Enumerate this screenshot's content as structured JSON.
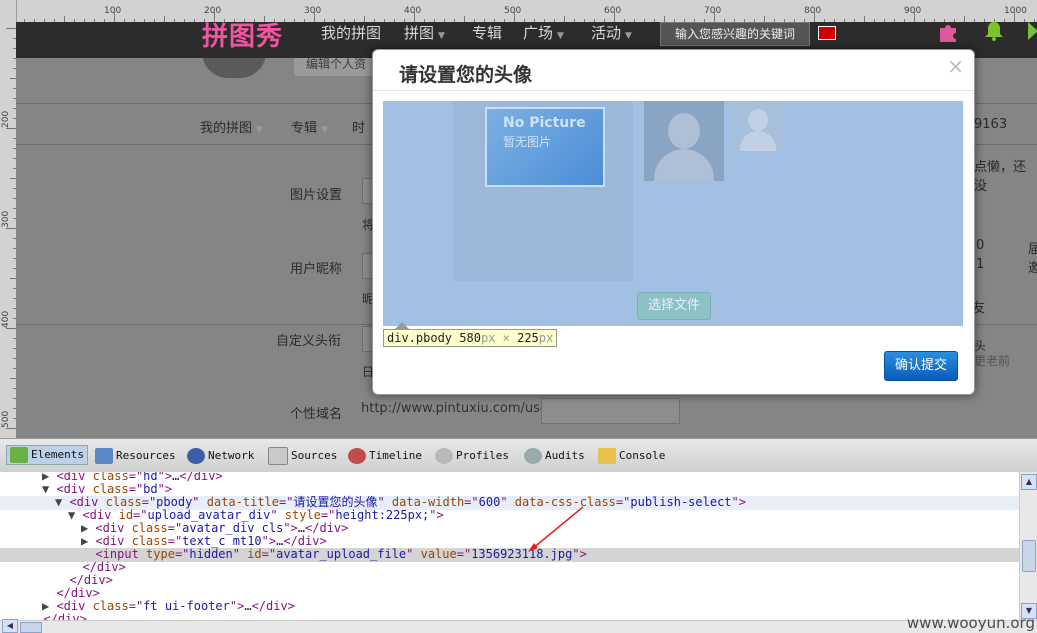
{
  "ruler": {
    "labels": [
      "100",
      "200",
      "300",
      "400",
      "500",
      "600",
      "700",
      "800",
      "900",
      "1000"
    ],
    "vlabels": [
      "200",
      "300",
      "400",
      "500"
    ]
  },
  "topnav": {
    "logo": "拼图秀",
    "items": [
      {
        "label": "我的拼图",
        "caret": false
      },
      {
        "label": "拼图",
        "caret": true
      },
      {
        "label": "专辑",
        "caret": false
      },
      {
        "label": "广场",
        "caret": true
      },
      {
        "label": "活动",
        "caret": true
      }
    ],
    "search_placeholder": "输入您感兴趣的关键词",
    "caret_glyph": "▼"
  },
  "page": {
    "edit_btn": "编辑个人资",
    "subnav": [
      "我的拼图",
      "专辑",
      "时"
    ],
    "caret_glyph": "▼",
    "right_num": "9163",
    "right_text": "点懒，还没",
    "field_photo": "图片设置",
    "field_photo_hint": "将",
    "field_nick": "用户昵称",
    "field_nick_hint": "昵",
    "field_custom": "自定义头衔",
    "field_custom_hint": "日",
    "field_domain": "个性域名",
    "domain_url": "http://www.pintuxiu.com/user/",
    "side_a": "0",
    "side_b": "1",
    "side_c": "友",
    "side_d": "头",
    "side_e": "更老前",
    "side_f": "届",
    "side_g": "邀"
  },
  "modal": {
    "title": "请设置您的头像",
    "close": "×",
    "nopic_en": "No Picture",
    "nopic_cn": "暂无图片",
    "choose_file": "选择文件",
    "confirm": "确认提交",
    "tooltip": {
      "tag": "div.pbody",
      "w": "580",
      "h": "225",
      "unit": "px",
      "sep": "×"
    }
  },
  "devtools": {
    "tabs": [
      {
        "label": "Elements",
        "active": true
      },
      {
        "label": "Resources",
        "active": false
      },
      {
        "label": "Network",
        "active": false
      },
      {
        "label": "Sources",
        "active": false
      },
      {
        "label": "Timeline",
        "active": false
      },
      {
        "label": "Profiles",
        "active": false
      },
      {
        "label": "Audits",
        "active": false
      },
      {
        "label": "Console",
        "active": false
      }
    ],
    "lines": [
      {
        "indent": 3,
        "tri": "▶",
        "html": "<div class=\"hd\">…</div>",
        "partial": true
      },
      {
        "indent": 3,
        "tri": "▼",
        "html": "<div class=\"bd\">"
      },
      {
        "indent": 4,
        "tri": "▼",
        "html": "<div class=\"pbody\" data-title=\"请设置您的头像\" data-width=\"600\" data-css-class=\"publish-select\">",
        "hover": true
      },
      {
        "indent": 5,
        "tri": "▼",
        "html": "<div id=\"upload_avatar_div\" style=\"height:225px;\">"
      },
      {
        "indent": 6,
        "tri": "▶",
        "html": "<div class=\"avatar_div cls\">…</div>"
      },
      {
        "indent": 6,
        "tri": "▶",
        "html": "<div class=\"text_c mt10\">…</div>"
      },
      {
        "indent": 6,
        "tri": "",
        "html": "<input type=\"hidden\" id=\"avatar_upload_file\" value=\"1356923118.jpg\">",
        "selected": true
      },
      {
        "indent": 5,
        "tri": "",
        "html": "</div>"
      },
      {
        "indent": 4,
        "tri": "",
        "html": "</div>"
      },
      {
        "indent": 3,
        "tri": "",
        "html": "</div>"
      },
      {
        "indent": 3,
        "tri": "▶",
        "html": "<div class=\"ft ui-footer\">…</div>"
      },
      {
        "indent": 2,
        "tri": "",
        "html": "</div>",
        "partial": true
      }
    ]
  },
  "watermark": "www.wooyun.org",
  "colors": {
    "accent": "#f0559f",
    "hover_row": "#e7eef8",
    "selected_row": "#d4d4d4",
    "arrow": "#e02020"
  }
}
